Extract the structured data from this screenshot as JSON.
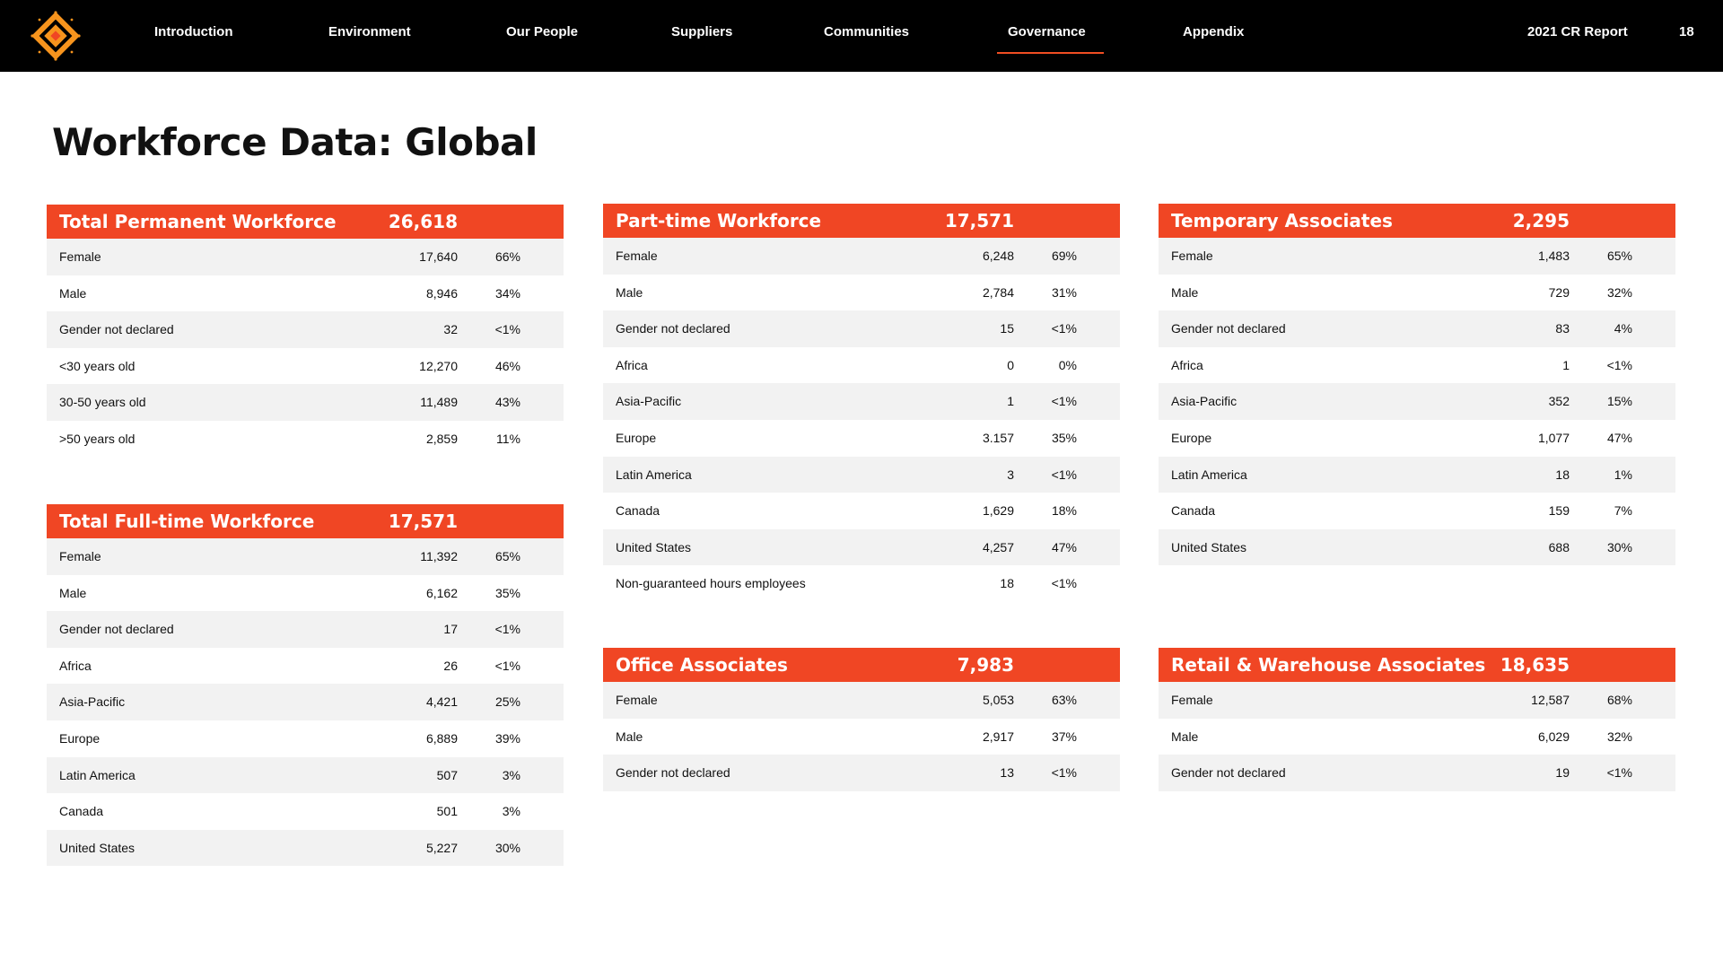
{
  "nav": {
    "items": [
      {
        "label": "Introduction"
      },
      {
        "label": "Environment"
      },
      {
        "label": "Our People"
      },
      {
        "label": "Suppliers"
      },
      {
        "label": "Communities"
      },
      {
        "label": "Governance",
        "active": true
      },
      {
        "label": "Appendix"
      }
    ],
    "report_label": "2021 CR Report",
    "page_number": "18"
  },
  "colors": {
    "accent": "#f04624",
    "nav_bg": "#000000",
    "stripe": "#f2f2f2",
    "logo_orange": "#f7941d"
  },
  "page_title": "Workforce Data: Global",
  "tables": [
    {
      "title": "Total Permanent Workforce",
      "total": "26,618",
      "rows": [
        {
          "label": "Female",
          "value": "17,640",
          "pct": "66%"
        },
        {
          "label": "Male",
          "value": "8,946",
          "pct": "34%"
        },
        {
          "label": "Gender not declared",
          "value": "32",
          "pct": "<1%"
        },
        {
          "label": "<30 years old",
          "value": "12,270",
          "pct": "46%"
        },
        {
          "label": "30-50 years old",
          "value": "11,489",
          "pct": "43%"
        },
        {
          "label": ">50 years old",
          "value": "2,859",
          "pct": "11%"
        }
      ]
    },
    {
      "title": "Total Full-time Workforce",
      "total": "17,571",
      "rows": [
        {
          "label": "Female",
          "value": "11,392",
          "pct": "65%"
        },
        {
          "label": "Male",
          "value": "6,162",
          "pct": "35%"
        },
        {
          "label": "Gender not declared",
          "value": "17",
          "pct": "<1%"
        },
        {
          "label": "Africa",
          "value": "26",
          "pct": "<1%"
        },
        {
          "label": "Asia-Pacific",
          "value": "4,421",
          "pct": "25%"
        },
        {
          "label": "Europe",
          "value": "6,889",
          "pct": "39%"
        },
        {
          "label": "Latin America",
          "value": "507",
          "pct": "3%"
        },
        {
          "label": "Canada",
          "value": "501",
          "pct": "3%"
        },
        {
          "label": "United States",
          "value": "5,227",
          "pct": "30%"
        }
      ]
    },
    {
      "title": "Part-time Workforce",
      "total": "17,571",
      "rows": [
        {
          "label": "Female",
          "value": "6,248",
          "pct": "69%"
        },
        {
          "label": "Male",
          "value": "2,784",
          "pct": "31%"
        },
        {
          "label": "Gender not declared",
          "value": "15",
          "pct": "<1%"
        },
        {
          "label": "Africa",
          "value": "0",
          "pct": "0%"
        },
        {
          "label": "Asia-Pacific",
          "value": "1",
          "pct": "<1%"
        },
        {
          "label": "Europe",
          "value": "3.157",
          "pct": "35%"
        },
        {
          "label": "Latin America",
          "value": "3",
          "pct": "<1%"
        },
        {
          "label": "Canada",
          "value": "1,629",
          "pct": "18%"
        },
        {
          "label": "United States",
          "value": "4,257",
          "pct": "47%"
        },
        {
          "label": "Non-guaranteed hours employees",
          "value": "18",
          "pct": "<1%"
        }
      ]
    },
    {
      "title": "Office Associates",
      "total": "7,983",
      "rows": [
        {
          "label": "Female",
          "value": "5,053",
          "pct": "63%"
        },
        {
          "label": "Male",
          "value": "2,917",
          "pct": "37%"
        },
        {
          "label": "Gender not declared",
          "value": "13",
          "pct": "<1%"
        }
      ]
    },
    {
      "title": "Temporary Associates",
      "total": "2,295",
      "rows": [
        {
          "label": "Female",
          "value": "1,483",
          "pct": "65%"
        },
        {
          "label": "Male",
          "value": "729",
          "pct": "32%"
        },
        {
          "label": "Gender not declared",
          "value": "83",
          "pct": "4%"
        },
        {
          "label": "Africa",
          "value": "1",
          "pct": "<1%"
        },
        {
          "label": "Asia-Pacific",
          "value": "352",
          "pct": "15%"
        },
        {
          "label": "Europe",
          "value": "1,077",
          "pct": "47%"
        },
        {
          "label": "Latin America",
          "value": "18",
          "pct": "1%"
        },
        {
          "label": "Canada",
          "value": "159",
          "pct": "7%"
        },
        {
          "label": "United States",
          "value": "688",
          "pct": "30%"
        }
      ]
    },
    {
      "title": "Retail & Warehouse Associates",
      "total": "18,635",
      "rows": [
        {
          "label": "Female",
          "value": "12,587",
          "pct": "68%"
        },
        {
          "label": "Male",
          "value": "6,029",
          "pct": "32%"
        },
        {
          "label": "Gender not declared",
          "value": "19",
          "pct": "<1%"
        }
      ]
    }
  ]
}
